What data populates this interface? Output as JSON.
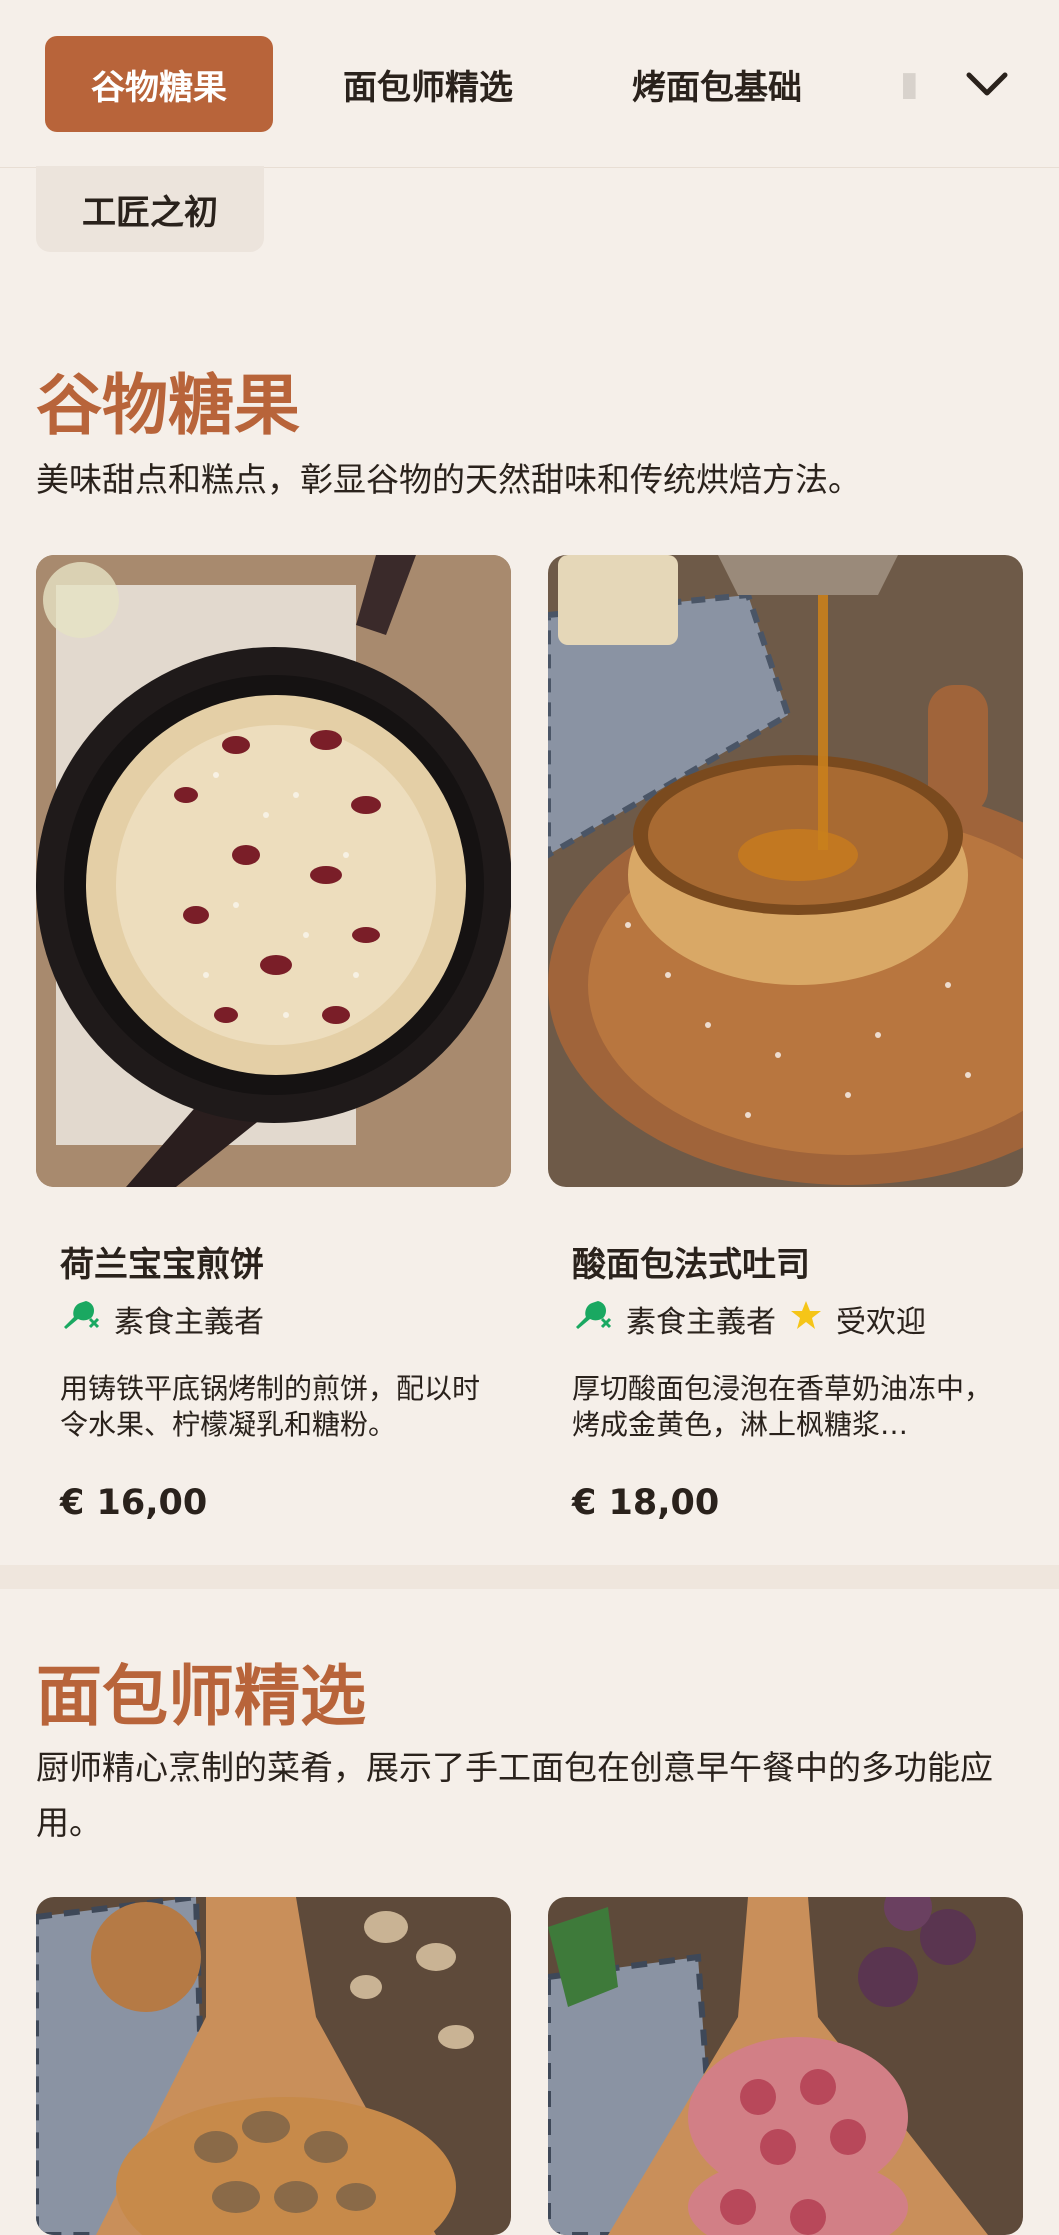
{
  "tabs": [
    {
      "label": "谷物糖果",
      "active": true
    },
    {
      "label": "面包师精选",
      "active": false
    },
    {
      "label": "烤面包基础",
      "active": false
    },
    {
      "label": "工匠之初",
      "active": false
    }
  ],
  "more_icon": "chevron-down-icon",
  "sections": [
    {
      "title": "谷物糖果",
      "description": "美味甜点和糕点，彰显谷物的天然甜味和传统烘焙方法。",
      "items": [
        {
          "name": "荷兰宝宝煎饼",
          "tags": [
            {
              "icon": "vegetarian-icon",
              "label": "素食主義者"
            }
          ],
          "description": "用铸铁平底锅烤制的煎饼，配以时令水果、柠檬凝乳和糖粉。",
          "price": "€ 16,00"
        },
        {
          "name": "酸面包法式吐司",
          "tags": [
            {
              "icon": "vegetarian-icon",
              "label": "素食主義者"
            },
            {
              "icon": "star-icon",
              "label": "受欢迎"
            }
          ],
          "description": "厚切酸面包浸泡在香草奶油冻中，烤成金黄色，淋上枫糖浆…",
          "price": "€ 18,00"
        }
      ]
    },
    {
      "title": "面包师精选",
      "description": "厨师精心烹制的菜肴，展示了手工面包在创意早午餐中的多功能应用。",
      "items": [
        {
          "image": "mushroom-toast"
        },
        {
          "image": "prosciutto-fig-toast"
        }
      ]
    }
  ],
  "colors": {
    "accent": "#b8643a",
    "background": "#f5efe9",
    "vegetarian_icon": "#1aa861",
    "star": "#f5c518"
  }
}
